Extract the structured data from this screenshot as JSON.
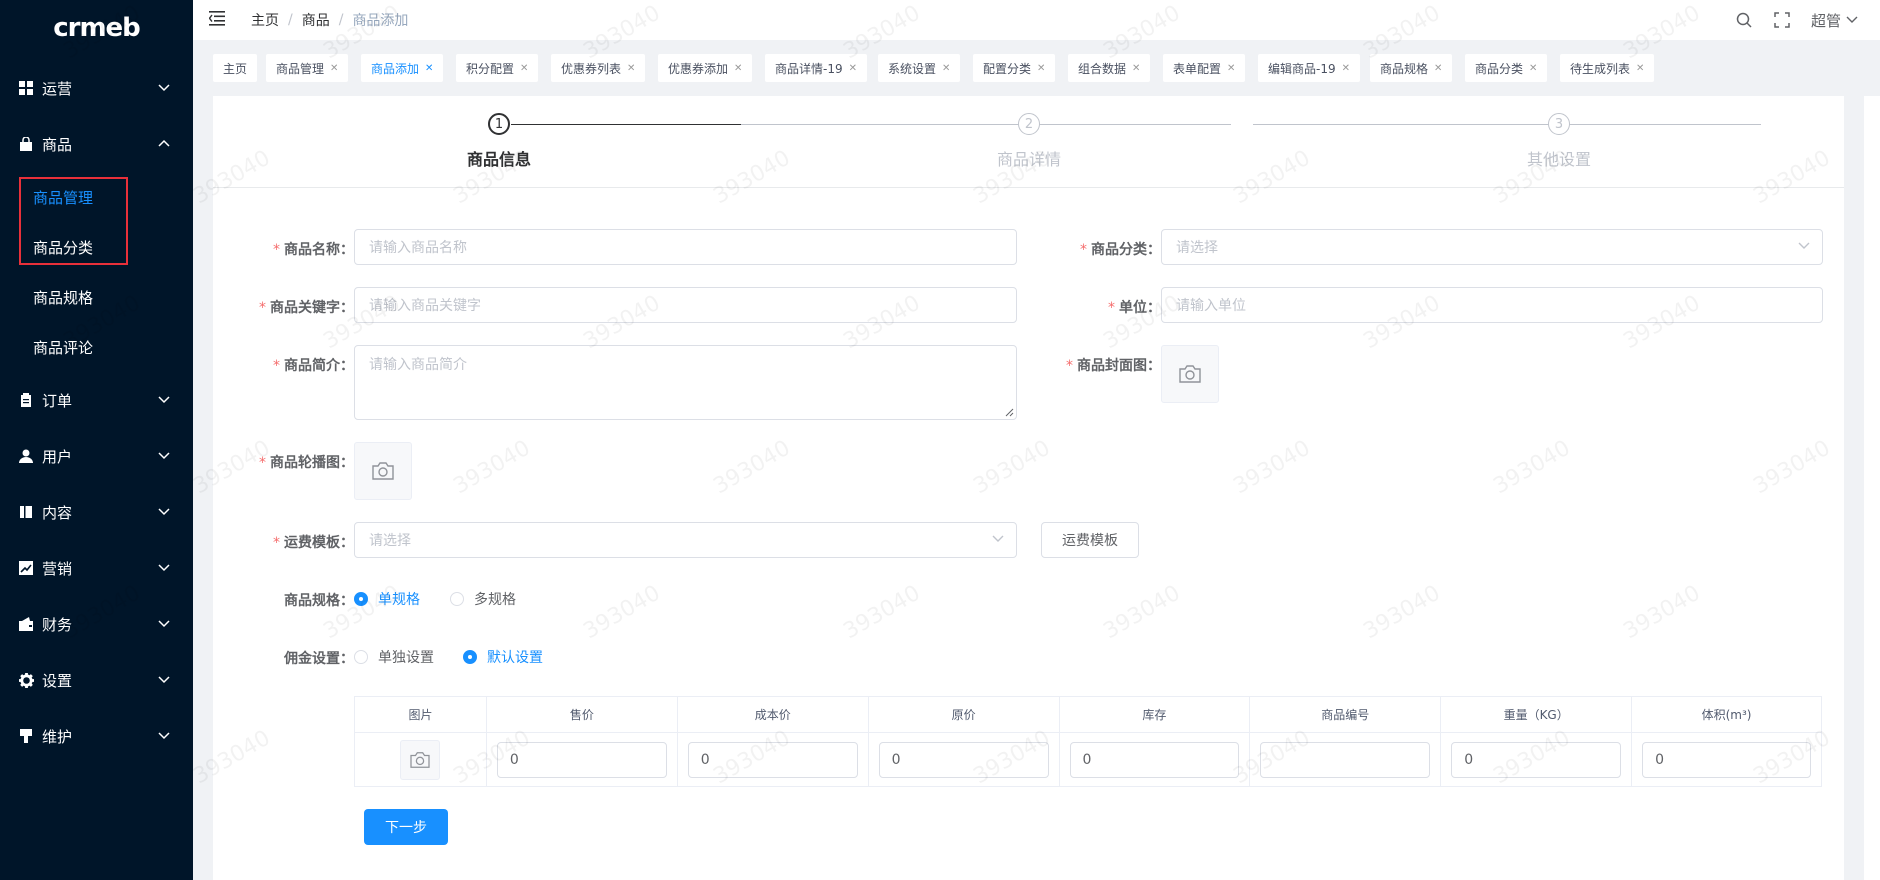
{
  "app": {
    "logo": "crmeb"
  },
  "sidebar": {
    "menus": [
      {
        "label": "运营",
        "icon": "grid-icon",
        "expanded": false
      },
      {
        "label": "商品",
        "icon": "bag-icon",
        "expanded": true
      },
      {
        "label": "订单",
        "icon": "clipboard-icon",
        "expanded": false
      },
      {
        "label": "用户",
        "icon": "user-icon",
        "expanded": false
      },
      {
        "label": "内容",
        "icon": "book-icon",
        "expanded": false
      },
      {
        "label": "营销",
        "icon": "chart-icon",
        "expanded": false
      },
      {
        "label": "财务",
        "icon": "wallet-icon",
        "expanded": false
      },
      {
        "label": "设置",
        "icon": "gear-icon",
        "expanded": false
      },
      {
        "label": "维护",
        "icon": "brush-icon",
        "expanded": false
      }
    ],
    "submenus": [
      {
        "label": "商品管理",
        "active": true
      },
      {
        "label": "商品分类",
        "active": false
      },
      {
        "label": "商品规格",
        "active": false
      },
      {
        "label": "商品评论",
        "active": false
      }
    ]
  },
  "header": {
    "breadcrumb": [
      "主页",
      "商品",
      "商品添加"
    ],
    "user": "超管"
  },
  "tags": [
    {
      "label": "主页",
      "closable": false,
      "active": false
    },
    {
      "label": "商品管理",
      "closable": true,
      "active": false
    },
    {
      "label": "商品添加",
      "closable": true,
      "active": true
    },
    {
      "label": "积分配置",
      "closable": true,
      "active": false
    },
    {
      "label": "优惠券列表",
      "closable": true,
      "active": false
    },
    {
      "label": "优惠券添加",
      "closable": true,
      "active": false
    },
    {
      "label": "商品详情-19",
      "closable": true,
      "active": false
    },
    {
      "label": "系统设置",
      "closable": true,
      "active": false
    },
    {
      "label": "配置分类",
      "closable": true,
      "active": false
    },
    {
      "label": "组合数据",
      "closable": true,
      "active": false
    },
    {
      "label": "表单配置",
      "closable": true,
      "active": false
    },
    {
      "label": "编辑商品-19",
      "closable": true,
      "active": false
    },
    {
      "label": "商品规格",
      "closable": true,
      "active": false
    },
    {
      "label": "商品分类",
      "closable": true,
      "active": false
    },
    {
      "label": "待生成列表",
      "closable": true,
      "active": false
    }
  ],
  "steps": [
    {
      "num": "1",
      "title": "商品信息",
      "active": true
    },
    {
      "num": "2",
      "title": "商品详情",
      "active": false
    },
    {
      "num": "3",
      "title": "其他设置",
      "active": false
    }
  ],
  "form": {
    "name": {
      "label": "商品名称：",
      "placeholder": "请输入商品名称"
    },
    "category": {
      "label": "商品分类：",
      "placeholder": "请选择"
    },
    "keywords": {
      "label": "商品关键字：",
      "placeholder": "请输入商品关键字"
    },
    "unit": {
      "label": "单位：",
      "placeholder": "请输入单位"
    },
    "intro": {
      "label": "商品简介：",
      "placeholder": "请输入商品简介"
    },
    "cover": {
      "label": "商品封面图："
    },
    "carousel": {
      "label": "商品轮播图："
    },
    "shipping": {
      "label": "运费模板：",
      "placeholder": "请选择",
      "button": "运费模板"
    },
    "spec": {
      "label": "商品规格：",
      "options": [
        "单规格",
        "多规格"
      ],
      "selected": 0
    },
    "commission": {
      "label": "佣金设置：",
      "options": [
        "单独设置",
        "默认设置"
      ],
      "selected": 1
    }
  },
  "sku_table": {
    "headers": [
      "图片",
      "售价",
      "成本价",
      "原价",
      "库存",
      "商品编号",
      "重量（KG）",
      "体积(m³)"
    ],
    "row": [
      "",
      "0",
      "0",
      "0",
      "0",
      "",
      "0",
      "0"
    ]
  },
  "next_button": "下一步",
  "watermark": "393040",
  "colors": {
    "primary": "#1890ff",
    "sidebar": "#001529",
    "required": "#f56c6c",
    "highlight": "#e8303a"
  }
}
